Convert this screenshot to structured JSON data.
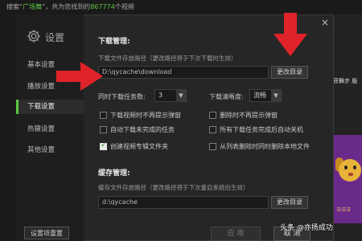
{
  "background": {
    "search_prefix": "搜索“",
    "search_term": "广场舞",
    "search_mid": "”，共为您找到约",
    "search_count": "867774",
    "search_suffix": "个视频",
    "right_text": "菲舞步 版",
    "poster_caption": "汪汪汪"
  },
  "dialog": {
    "title": "设置",
    "close_label": "×",
    "nav": [
      {
        "label": "基本设置",
        "active": false
      },
      {
        "label": "播放设置",
        "active": false
      },
      {
        "label": "下载设置",
        "active": true
      },
      {
        "label": "热键设置",
        "active": false
      },
      {
        "label": "其他设置",
        "active": false
      }
    ],
    "reset_label": "设置项重置",
    "apply_label": "应 用",
    "cancel_label": "取 消"
  },
  "download": {
    "section_title": "下载管理:",
    "path_hint": "下载文件存放路径（更改路径将于下次下载时生效）",
    "path_value": "D:\\qycache\\download",
    "change_dir_label": "更改目录",
    "simultaneous_label": "同时下载任务数:",
    "simultaneous_value": "3",
    "quality_label": "下载清晰度:",
    "quality_value": "流畅",
    "options": [
      {
        "label": "下载视频时不再提示弹窗",
        "checked": false
      },
      {
        "label": "删除时不再提示弹窗",
        "checked": false
      },
      {
        "label": "自动下载未完成的任务",
        "checked": false
      },
      {
        "label": "所有下载任务完成后自动关机",
        "checked": false
      },
      {
        "label": "创建视频专辑文件夹",
        "checked": true
      },
      {
        "label": "从列表删除时同时删除本地文件",
        "checked": false
      }
    ]
  },
  "cache": {
    "section_title": "缓存管理:",
    "path_hint": "缓存文件存放路径（更改路径将于下次重启系统后生效）",
    "path_value": "d:\\qycache",
    "change_dir_label": "更改目录"
  },
  "watermark": "头条 @亦扬成功",
  "colors": {
    "accent": "#5ec642",
    "arrow": "#e0232a"
  }
}
